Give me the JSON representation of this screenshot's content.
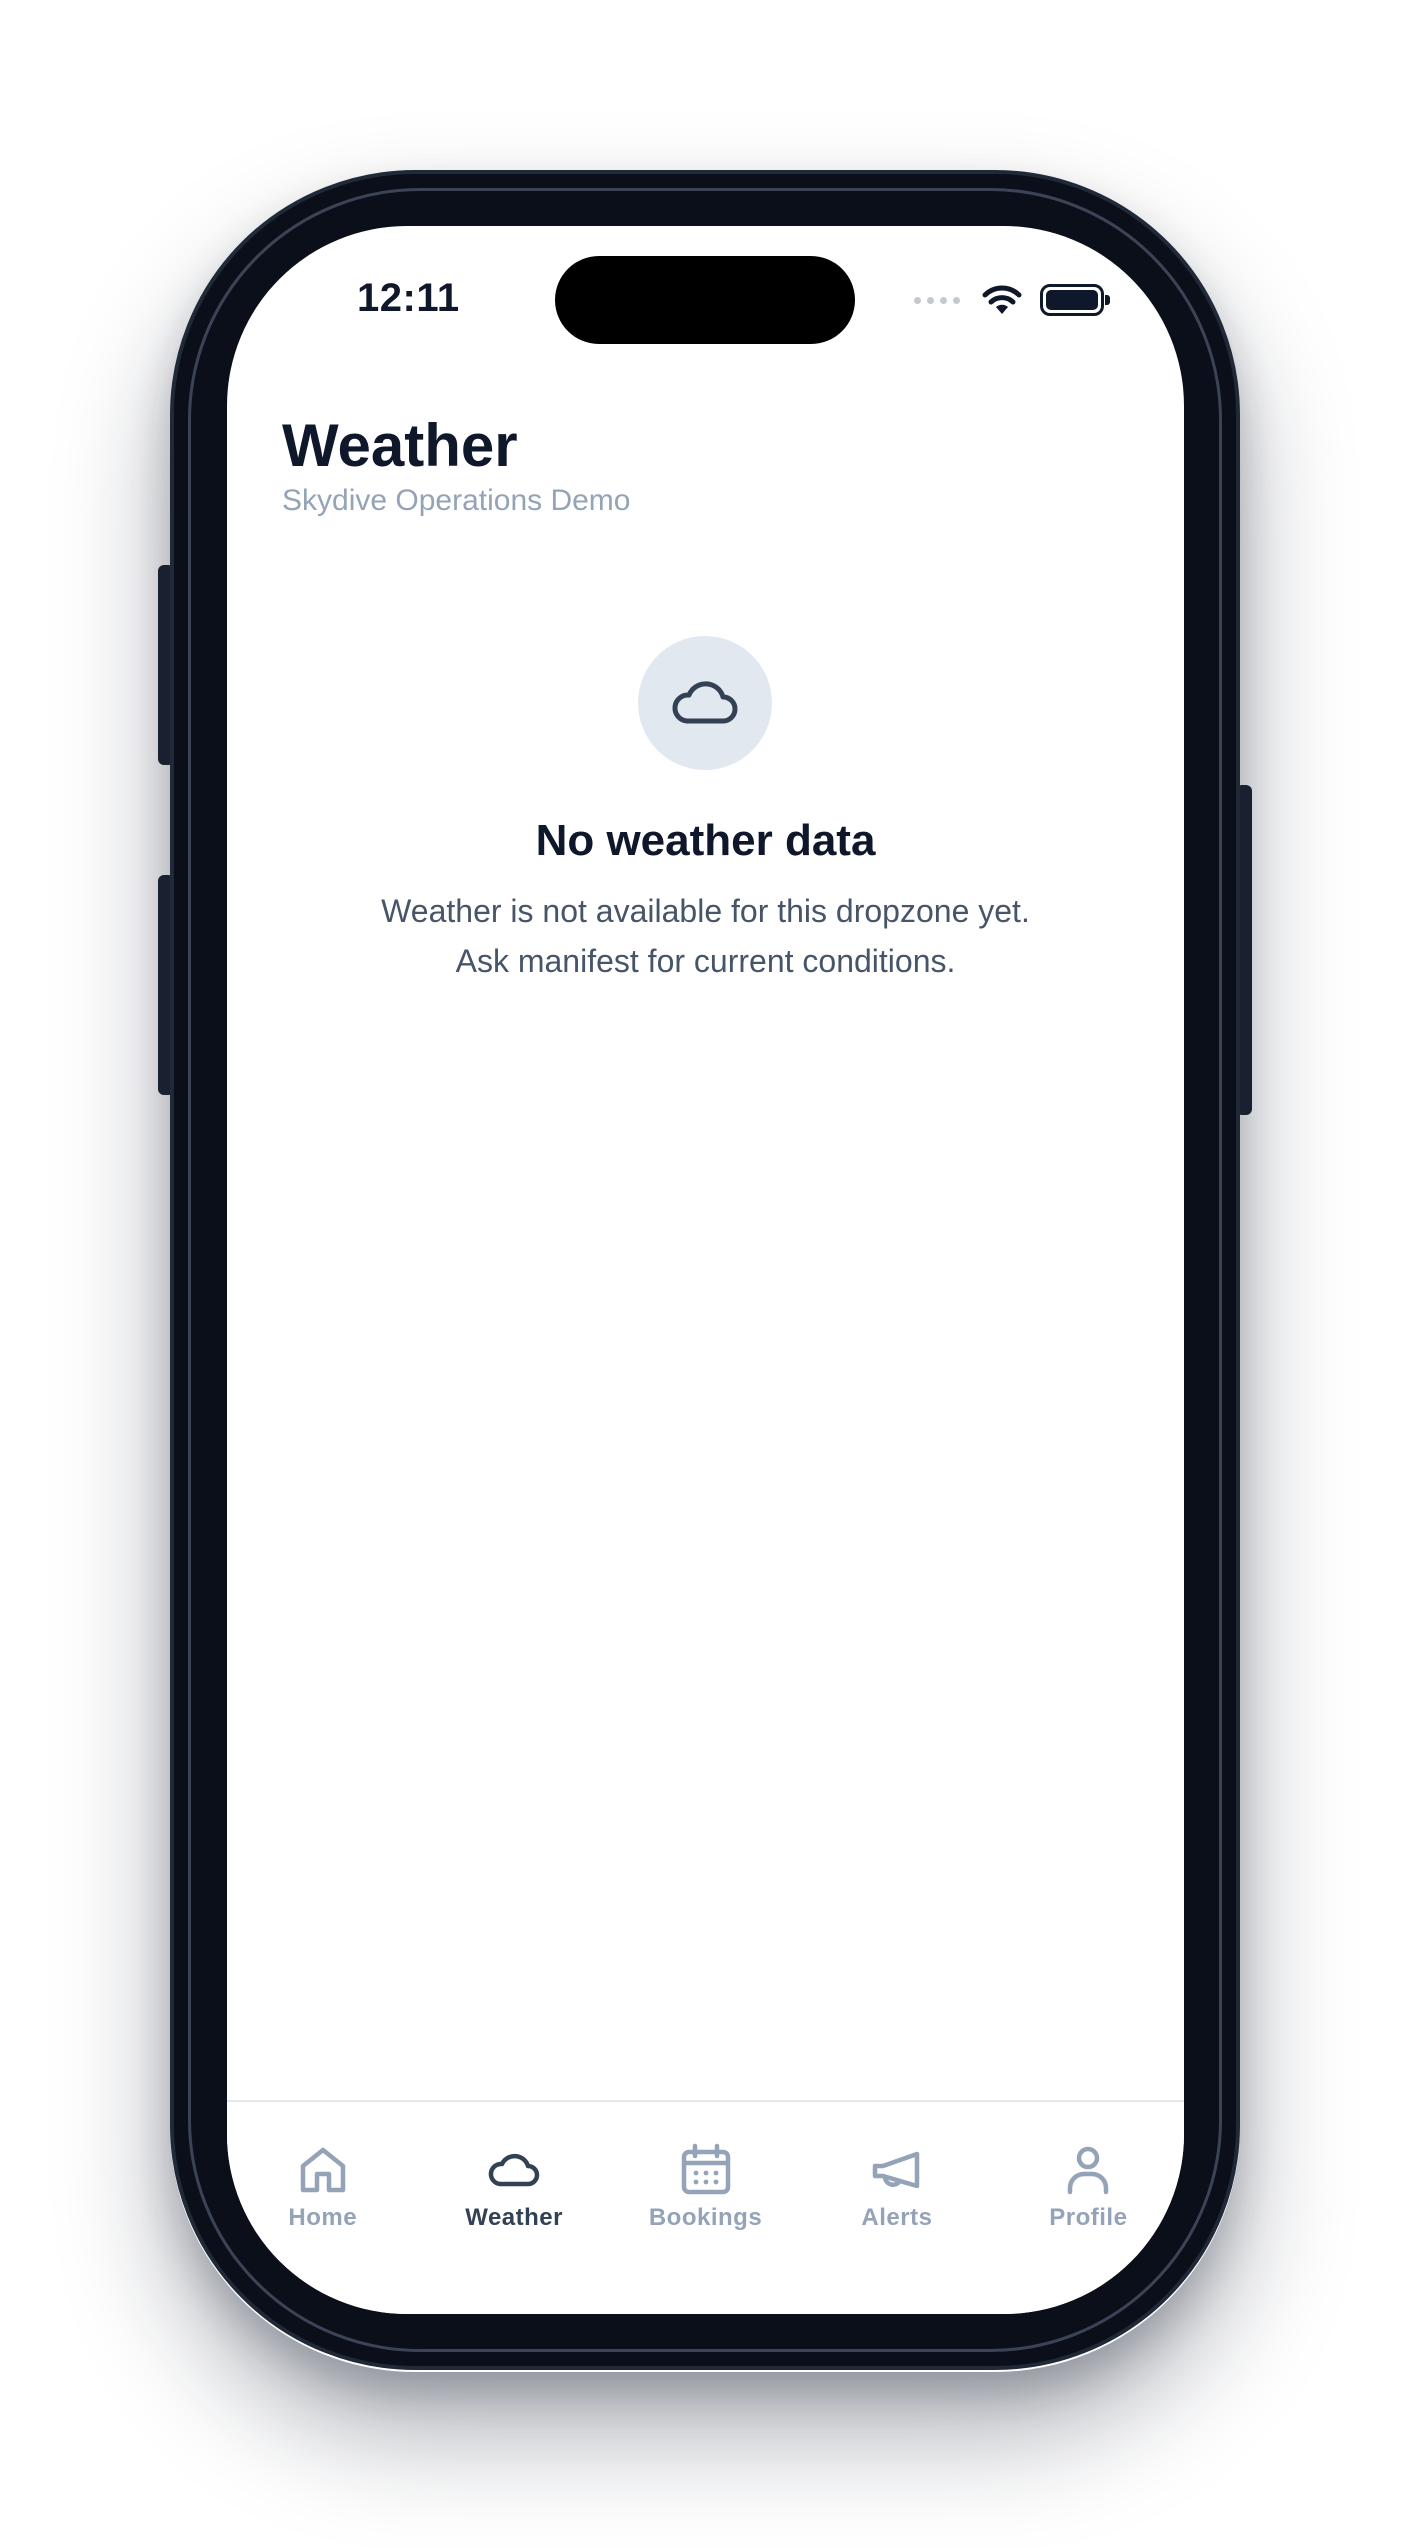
{
  "status_bar": {
    "time": "12:11"
  },
  "header": {
    "title": "Weather",
    "subtitle": "Skydive Operations Demo"
  },
  "empty_state": {
    "icon": "cloud-icon",
    "title": "No weather data",
    "message": "Weather is not available for this dropzone yet. Ask manifest for current conditions."
  },
  "tab_bar": {
    "tabs": [
      {
        "label": "Home",
        "icon": "home-icon",
        "active": false
      },
      {
        "label": "Weather",
        "icon": "cloud-icon",
        "active": true
      },
      {
        "label": "Bookings",
        "icon": "calendar-icon",
        "active": false
      },
      {
        "label": "Alerts",
        "icon": "megaphone-icon",
        "active": false
      },
      {
        "label": "Profile",
        "icon": "person-icon",
        "active": false
      }
    ]
  },
  "colors": {
    "text_primary": "#0f172a",
    "text_secondary": "#475569",
    "text_muted": "#94a3b8",
    "tab_active": "#334155",
    "icon_circle_bg": "#e2e8f0"
  }
}
